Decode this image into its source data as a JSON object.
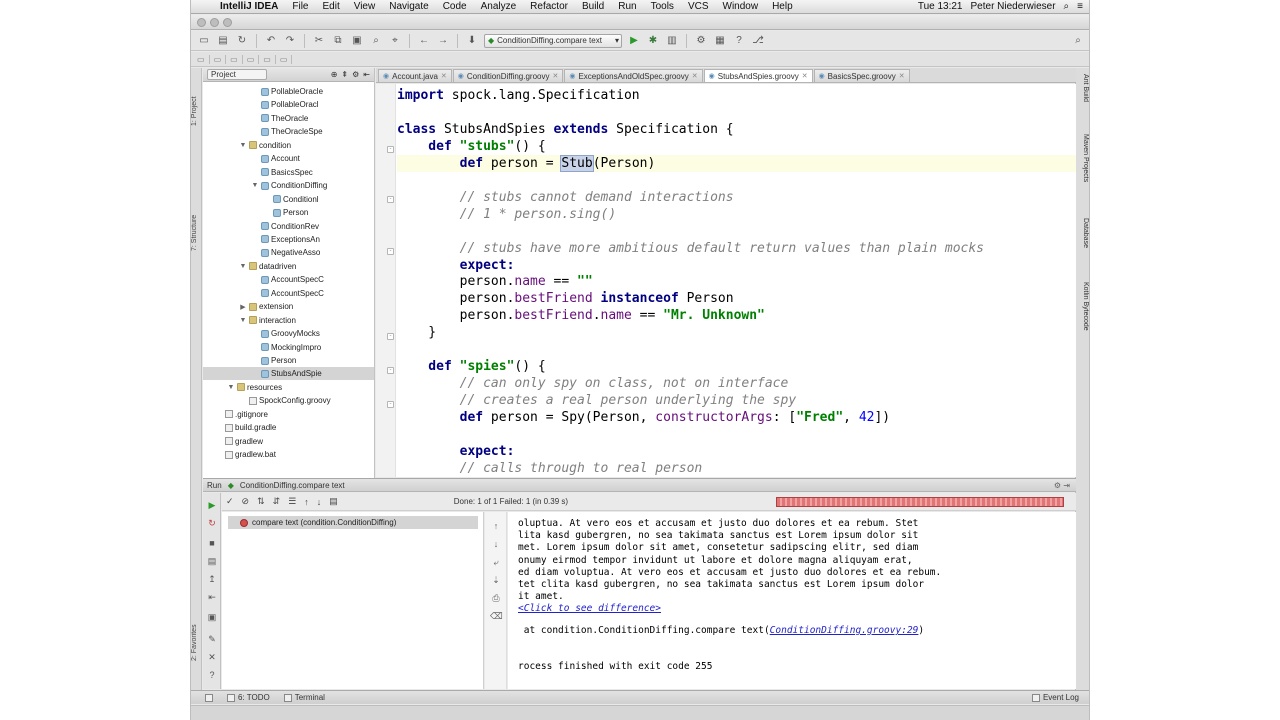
{
  "menubar": {
    "app_name": "IntelliJ IDEA",
    "items": [
      "File",
      "Edit",
      "View",
      "Navigate",
      "Code",
      "Analyze",
      "Refactor",
      "Build",
      "Run",
      "Tools",
      "VCS",
      "Window",
      "Help"
    ],
    "clock": "Tue 13:21",
    "user": "Peter Niederwieser"
  },
  "toolbar": {
    "run_config_label": "ConditionDiffing.compare text"
  },
  "project_panel": {
    "view_selector": "Project",
    "tree": [
      {
        "label": "PollableOracle",
        "kind": "class",
        "depth": 4,
        "twisty": ""
      },
      {
        "label": "PollableOracl",
        "kind": "class",
        "depth": 4,
        "twisty": ""
      },
      {
        "label": "TheOracle",
        "kind": "class",
        "depth": 4,
        "twisty": ""
      },
      {
        "label": "TheOracleSpe",
        "kind": "class",
        "depth": 4,
        "twisty": ""
      },
      {
        "label": "condition",
        "kind": "folder",
        "depth": 3,
        "twisty": "▼"
      },
      {
        "label": "Account",
        "kind": "class",
        "depth": 4,
        "twisty": ""
      },
      {
        "label": "BasicsSpec",
        "kind": "class",
        "depth": 4,
        "twisty": ""
      },
      {
        "label": "ConditionDiffing",
        "kind": "class",
        "depth": 4,
        "twisty": "▼"
      },
      {
        "label": "Conditionl",
        "kind": "class",
        "depth": 5,
        "twisty": ""
      },
      {
        "label": "Person",
        "kind": "class",
        "depth": 5,
        "twisty": ""
      },
      {
        "label": "ConditionRev",
        "kind": "class",
        "depth": 4,
        "twisty": ""
      },
      {
        "label": "ExceptionsAn",
        "kind": "class",
        "depth": 4,
        "twisty": ""
      },
      {
        "label": "NegativeAsso",
        "kind": "class",
        "depth": 4,
        "twisty": ""
      },
      {
        "label": "datadriven",
        "kind": "folder",
        "depth": 3,
        "twisty": "▼"
      },
      {
        "label": "AccountSpecC",
        "kind": "class",
        "depth": 4,
        "twisty": ""
      },
      {
        "label": "AccountSpecC",
        "kind": "class",
        "depth": 4,
        "twisty": ""
      },
      {
        "label": "extension",
        "kind": "folder",
        "depth": 3,
        "twisty": "▶"
      },
      {
        "label": "interaction",
        "kind": "folder",
        "depth": 3,
        "twisty": "▼"
      },
      {
        "label": "GroovyMocks",
        "kind": "class",
        "depth": 4,
        "twisty": ""
      },
      {
        "label": "MockingImpro",
        "kind": "class",
        "depth": 4,
        "twisty": ""
      },
      {
        "label": "Person",
        "kind": "class",
        "depth": 4,
        "twisty": ""
      },
      {
        "label": "StubsAndSpie",
        "kind": "class",
        "depth": 4,
        "twisty": "",
        "selected": true
      },
      {
        "label": "resources",
        "kind": "folder",
        "depth": 2,
        "twisty": "▼"
      },
      {
        "label": "SpockConfig.groovy",
        "kind": "file",
        "depth": 3,
        "twisty": ""
      },
      {
        "label": ".gitignore",
        "kind": "file",
        "depth": 1,
        "twisty": ""
      },
      {
        "label": "build.gradle",
        "kind": "file",
        "depth": 1,
        "twisty": ""
      },
      {
        "label": "gradlew",
        "kind": "file",
        "depth": 1,
        "twisty": ""
      },
      {
        "label": "gradlew.bat",
        "kind": "file",
        "depth": 1,
        "twisty": ""
      }
    ]
  },
  "editor_tabs": [
    {
      "label": "Account.java",
      "active": false
    },
    {
      "label": "ConditionDiffing.groovy",
      "active": false
    },
    {
      "label": "ExceptionsAndOldSpec.groovy",
      "active": false
    },
    {
      "label": "StubsAndSpies.groovy",
      "active": true
    },
    {
      "label": "BasicsSpec.groovy",
      "active": false
    }
  ],
  "editor": {
    "lines": [
      [
        {
          "t": "import ",
          "c": "kw"
        },
        {
          "t": "spock.lang.Specification",
          "c": ""
        }
      ],
      [],
      [
        {
          "t": "class ",
          "c": "kw"
        },
        {
          "t": "StubsAndSpies ",
          "c": ""
        },
        {
          "t": "extends ",
          "c": "kw"
        },
        {
          "t": "Specification {",
          "c": ""
        }
      ],
      [
        {
          "t": "    def ",
          "c": "kw"
        },
        {
          "t": "\"stubs\"",
          "c": "str"
        },
        {
          "t": "() {",
          "c": ""
        }
      ],
      [
        {
          "t": "        def ",
          "c": "kw"
        },
        {
          "t": "person = ",
          "c": ""
        },
        {
          "t": "Stub",
          "c": "hl"
        },
        {
          "t": "(Person)",
          "c": ""
        }
      ],
      [],
      [
        {
          "t": "        // stubs cannot demand interactions",
          "c": "cmt"
        }
      ],
      [
        {
          "t": "        // 1 * person.sing()",
          "c": "cmt"
        }
      ],
      [],
      [
        {
          "t": "        // stubs have more ambitious default return values than plain mocks",
          "c": "cmt"
        }
      ],
      [
        {
          "t": "        expect:",
          "c": "kw"
        }
      ],
      [
        {
          "t": "        person.",
          "c": ""
        },
        {
          "t": "name",
          "c": "fld"
        },
        {
          "t": " == ",
          "c": ""
        },
        {
          "t": "\"\"",
          "c": "str"
        }
      ],
      [
        {
          "t": "        person.",
          "c": ""
        },
        {
          "t": "bestFriend ",
          "c": "fld"
        },
        {
          "t": "instanceof ",
          "c": "kw"
        },
        {
          "t": "Person",
          "c": ""
        }
      ],
      [
        {
          "t": "        person.",
          "c": ""
        },
        {
          "t": "bestFriend",
          "c": "fld"
        },
        {
          "t": ".",
          "c": ""
        },
        {
          "t": "name",
          "c": "fld"
        },
        {
          "t": " == ",
          "c": ""
        },
        {
          "t": "\"Mr. Unknown\"",
          "c": "str"
        }
      ],
      [
        {
          "t": "    }",
          "c": ""
        }
      ],
      [],
      [
        {
          "t": "    def ",
          "c": "kw"
        },
        {
          "t": "\"spies\"",
          "c": "str"
        },
        {
          "t": "() {",
          "c": ""
        }
      ],
      [
        {
          "t": "        // can only spy on class, not on interface",
          "c": "cmt"
        }
      ],
      [
        {
          "t": "        // creates a real person underlying the spy",
          "c": "cmt"
        }
      ],
      [
        {
          "t": "        def ",
          "c": "kw"
        },
        {
          "t": "person = Spy(Person, ",
          "c": ""
        },
        {
          "t": "constructorArgs",
          "c": "fld"
        },
        {
          "t": ": [",
          "c": ""
        },
        {
          "t": "\"Fred\"",
          "c": "str"
        },
        {
          "t": ", ",
          "c": ""
        },
        {
          "t": "42",
          "c": "num"
        },
        {
          "t": "])",
          "c": ""
        }
      ],
      [],
      [
        {
          "t": "        expect:",
          "c": "kw"
        }
      ],
      [
        {
          "t": "        // calls through to real person",
          "c": "cmt"
        }
      ]
    ]
  },
  "run_panel": {
    "title": "Run",
    "config": "ConditionDiffing.compare text",
    "status": "Done: 1 of 1    Failed: 1 (in 0.39 s)",
    "test_item": "compare text (condition.ConditionDiffing)",
    "progress_failed_fraction": 1.0,
    "console_lines": [
      {
        "t": "oluptua. At vero eos et accusam et justo duo dolores et ea rebum. Stet",
        "link": false
      },
      {
        "t": "lita kasd gubergren, no sea takimata sanctus est Lorem ipsum dolor sit",
        "link": false
      },
      {
        "t": "met. Lorem ipsum dolor sit amet, consetetur sadipscing elitr, sed diam",
        "link": false
      },
      {
        "t": "onumy eirmod tempor invidunt ut labore et dolore magna aliquyam erat,",
        "link": false
      },
      {
        "t": "ed diam voluptua. At vero eos et accusam et justo duo dolores et ea rebum.",
        "link": false
      },
      {
        "t": "tet clita kasd gubergren, no sea takimata sanctus est Lorem ipsum dolor",
        "link": false
      },
      {
        "t": "it amet.",
        "link": false
      },
      {
        "t": "<Click to see difference>",
        "link": true
      }
    ],
    "stack_prefix": " at condition.ConditionDiffing.compare text(",
    "stack_link": "ConditionDiffing.groovy:29",
    "stack_suffix": ")",
    "exit_line": "rocess finished with exit code 255"
  },
  "bottom_bar": {
    "todo": "6: TODO",
    "terminal": "Terminal",
    "event_log": "Event Log"
  },
  "right_stripe": [
    "Ant Build",
    "Maven Projects",
    "Database",
    "Kotlin Bytecode"
  ],
  "left_stripe": [
    "1: Project",
    "7: Structure",
    "2: Favorites"
  ]
}
